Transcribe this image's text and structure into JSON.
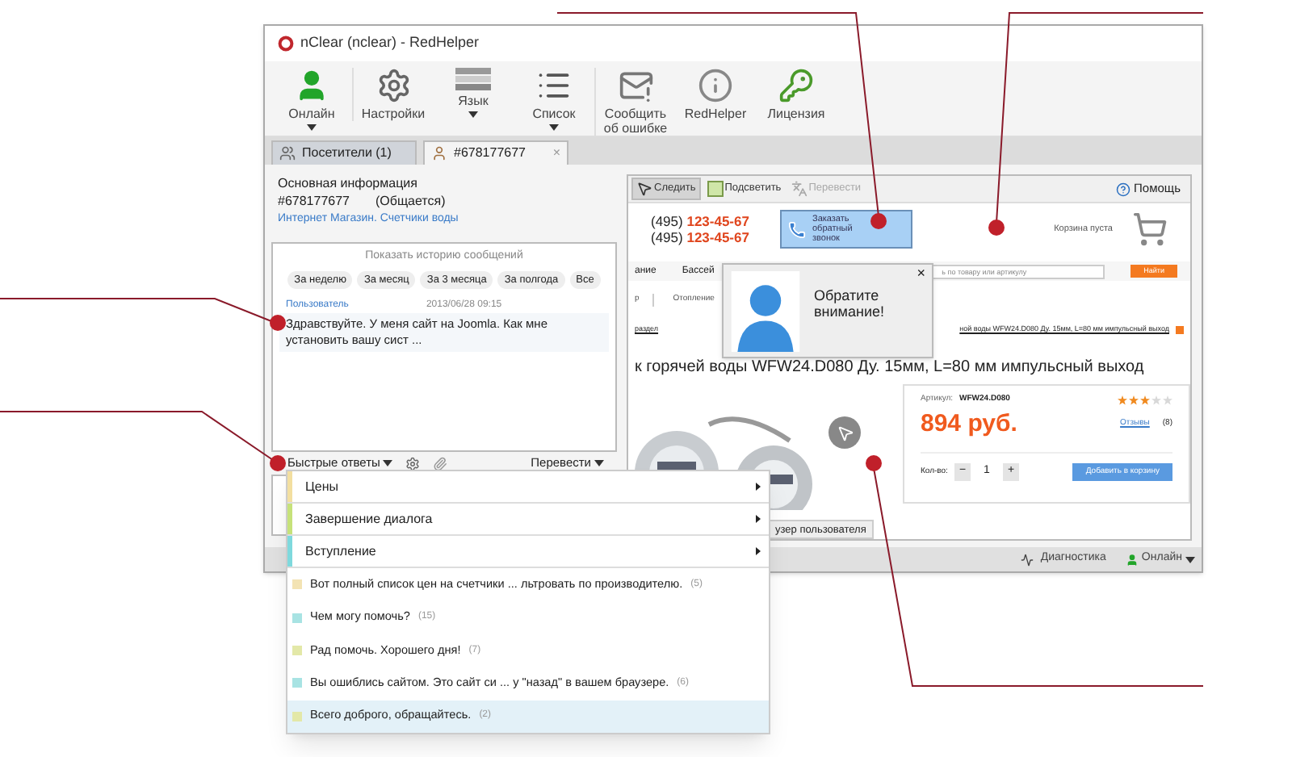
{
  "window": {
    "title": "nClear (nclear) - RedHelper"
  },
  "toolbar": [
    {
      "label": "Онлайн",
      "kind": "user",
      "dropdown": true
    },
    {
      "label": "Настройки",
      "kind": "gear",
      "dropdown": false
    },
    {
      "label": "Язык",
      "kind": "bars",
      "dropdown": true
    },
    {
      "label": "Список",
      "kind": "list",
      "dropdown": true
    },
    {
      "label": "Сообщить об ошибке",
      "kind": "report",
      "dropdown": false
    },
    {
      "label": "RedHelper",
      "kind": "info",
      "dropdown": false
    },
    {
      "label": "Лицензия",
      "kind": "key",
      "dropdown": false
    }
  ],
  "tabs": [
    {
      "label": "Посетители (1)",
      "selected": false,
      "kind": "visitors"
    },
    {
      "label": "#678177677",
      "selected": true,
      "kind": "visitor",
      "close": "×"
    }
  ],
  "visitor": {
    "heading": "Основная информация",
    "id": "#678177677",
    "status": "(Общается)",
    "site": "Интернет Магазин. Счетчики воды"
  },
  "history": {
    "title": "Показать историю сообщений",
    "filters": [
      "За неделю",
      "За месяц",
      "За 3 месяца",
      "За полгода",
      "Все"
    ]
  },
  "messages": [
    {
      "author": "Пользователь",
      "time": "2013/06/28 09:15",
      "text": "Здравствуйте. У меня сайт на Joomla. Как мне установить вашу сист ..."
    }
  ],
  "chat_toolbar": {
    "quick_replies": "Быстрые ответы",
    "translate": "Перевести"
  },
  "browser_tools": [
    {
      "label": "Следить",
      "selected": true,
      "disabled": false,
      "kind": "cursor"
    },
    {
      "label": "Подсветить",
      "selected": false,
      "disabled": false,
      "kind": "highlight"
    },
    {
      "label": "Перевести",
      "selected": false,
      "disabled": true,
      "kind": "translate"
    }
  ],
  "help": "Помощь",
  "site": {
    "phones": [
      {
        "code": "(495)",
        "number": "123-45-67"
      },
      {
        "code": "(495)",
        "number": "123-45-67"
      }
    ],
    "callback": "Заказать обратный звонок",
    "cart": "Корзина пуста",
    "nav": [
      "ание",
      "Бассей"
    ],
    "search_placeholder": "ь по товару или артикулу",
    "search_button": "Найти",
    "breadcrumbs": [
      "р",
      "Отопление"
    ],
    "section_link": "раздел",
    "product_link": "ной воды WFW24.D080 Ду. 15мм, L=80 мм импульсный выход",
    "product_title": "к горячей воды WFW24.D080 Ду. 15мм, L=80 мм импульсный выход",
    "article_label": "Артикул:",
    "article": "WFW24.D080",
    "price": "894 руб.",
    "stars": 3,
    "reviews": "Отзывы",
    "reviews_count": "(8)",
    "qty_label": "Кол-во:",
    "minus": "−",
    "qty": "1",
    "plus": "+",
    "add_button": "Добавить в корзину"
  },
  "browser_tab": "узер пользователя",
  "popup": {
    "text": "Обратите внимание!",
    "close": "×"
  },
  "status_bar": {
    "diagnostics": "Диагностика",
    "status": "Онлайн"
  },
  "quick_menu": {
    "groups": [
      {
        "label": "Цены",
        "color": "#f3dfa0"
      },
      {
        "label": "Завершение диалога",
        "color": "#c6e27a"
      },
      {
        "label": "Вступление",
        "color": "#7fd9dd"
      }
    ],
    "replies": [
      {
        "text": "Вот полный список цен на счетчики ... льтровать по производителю.",
        "count": "(5)",
        "color": "#f3e3b3",
        "selected": false
      },
      {
        "text": "Чем могу помочь?",
        "count": "(15)",
        "color": "#a8e3e3",
        "selected": false
      },
      {
        "text": "Рад помочь. Хорошего дня!",
        "count": "(7)",
        "color": "#e3e8a8",
        "selected": false
      },
      {
        "text": "Вы ошиблись сайтом. Это сайт си ... у \"назад\" в вашем браузере.",
        "count": "(6)",
        "color": "#a8e3e3",
        "selected": false
      },
      {
        "text": "Всего доброго, обращайтесь.",
        "count": "(2)",
        "color": "#e3e8a8",
        "selected": true
      }
    ]
  }
}
